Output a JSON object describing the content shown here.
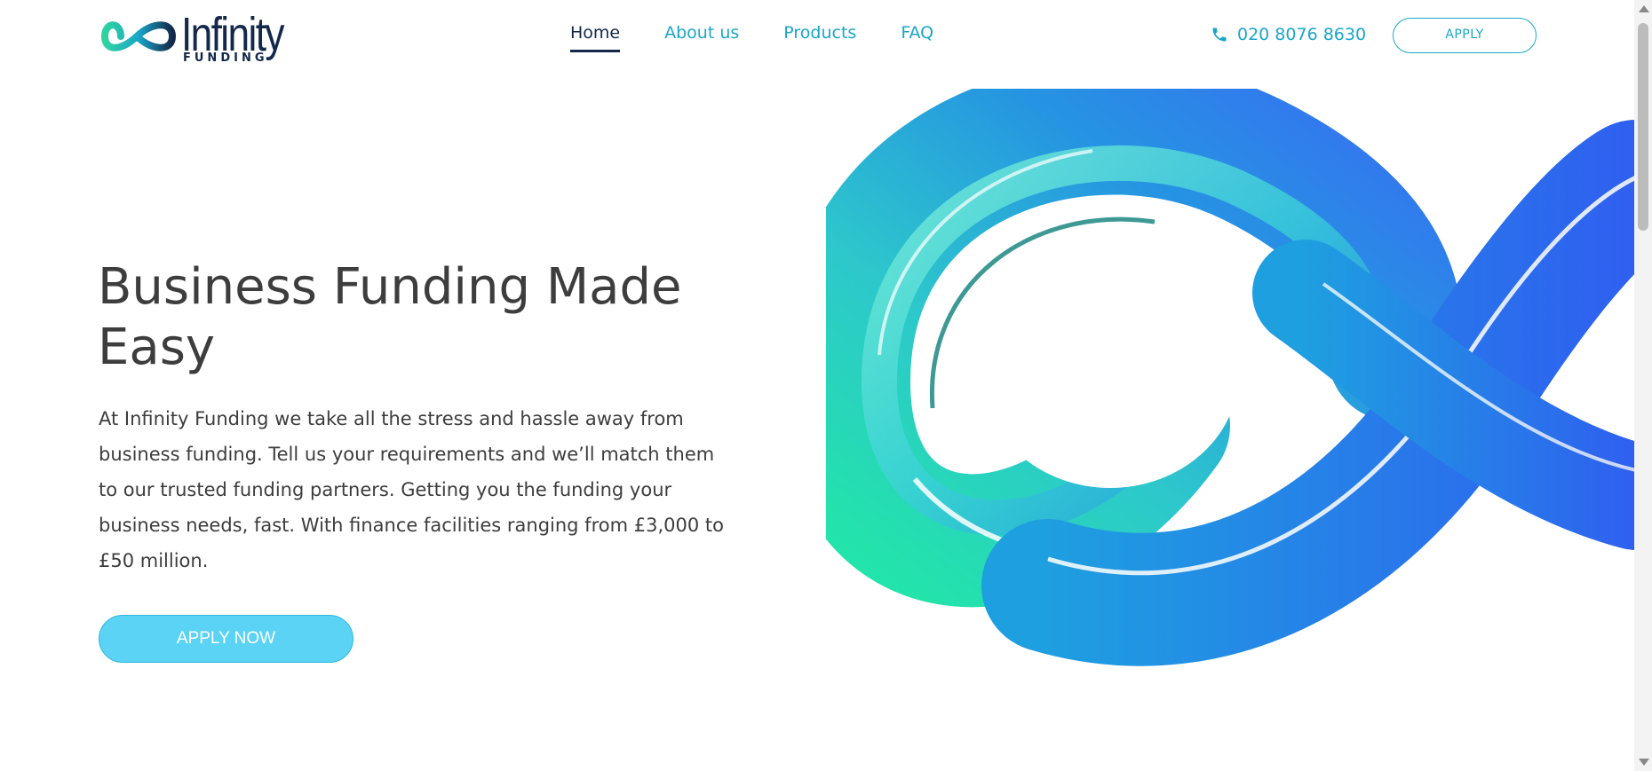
{
  "brand": {
    "name": "Infinity",
    "subtitle": "FUNDING",
    "colors": {
      "navy": "#13284a",
      "accent": "#1aa6c9",
      "button": "#5ad3f5"
    }
  },
  "nav": {
    "items": [
      {
        "label": "Home",
        "active": true
      },
      {
        "label": "About us",
        "active": false
      },
      {
        "label": "Products",
        "active": false
      },
      {
        "label": "FAQ",
        "active": false
      }
    ]
  },
  "header": {
    "phone_icon": "phone-icon",
    "phone": "020 8076 8630",
    "apply_label": "APPLY"
  },
  "hero": {
    "title": "Business Funding Made Easy",
    "text": "At Infinity Funding we take all the stress and hassle away from business funding. Tell us your requirements and we’ll match them to our trusted funding partners. Getting you the funding your business needs, fast. With finance facilities ranging from £3,000 to £50 million.",
    "cta_label": "APPLY NOW",
    "image": "infinity-ribbon-graphic"
  }
}
